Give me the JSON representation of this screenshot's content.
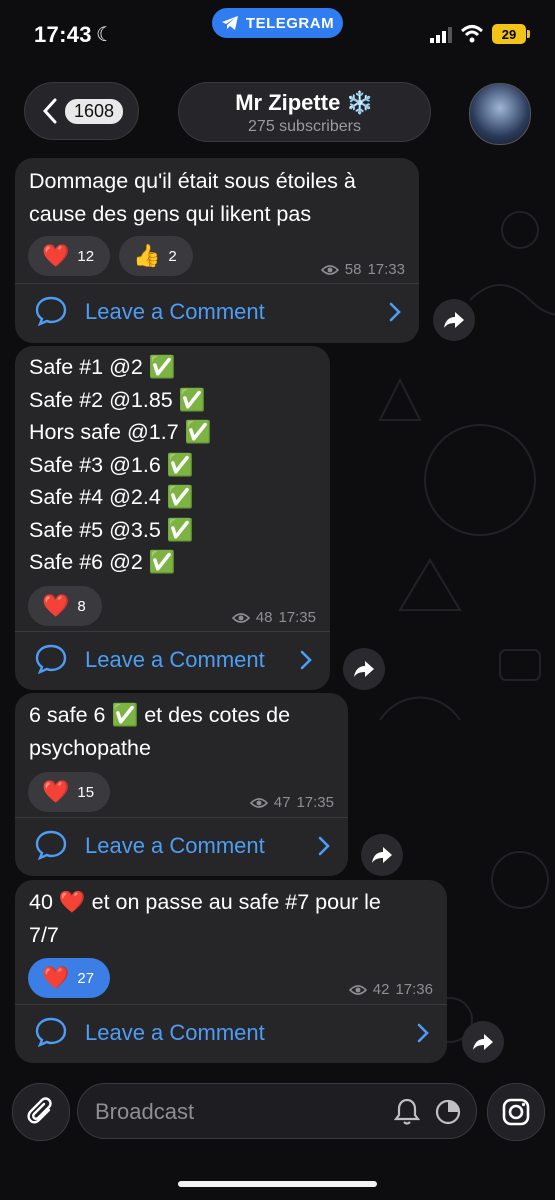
{
  "status_bar": {
    "time": "17:43",
    "battery": "29",
    "banner": "TELEGRAM"
  },
  "header": {
    "back_count": "1608",
    "channel_name": "Mr Zipette ❄️",
    "subscribers": "275 subscribers"
  },
  "messages": [
    {
      "text": "Dommage qu'il était sous étoiles à\ncause des gens qui likent pas",
      "reactions": [
        {
          "emoji": "❤️",
          "count": "12"
        },
        {
          "emoji": "👍",
          "count": "2"
        }
      ],
      "views": "58",
      "time": "17:33",
      "comment_label": "Leave a Comment"
    },
    {
      "text": "Safe #1 @2 ✅\nSafe #2 @1.85 ✅\nHors safe @1.7 ✅\nSafe #3 @1.6 ✅\nSafe #4 @2.4 ✅\nSafe #5 @3.5 ✅\nSafe #6 @2 ✅",
      "reactions": [
        {
          "emoji": "❤️",
          "count": "8"
        }
      ],
      "views": "48",
      "time": "17:35",
      "comment_label": "Leave a Comment"
    },
    {
      "text": "6 safe 6 ✅ et des cotes de\npsychopathe",
      "reactions": [
        {
          "emoji": "❤️",
          "count": "15"
        }
      ],
      "views": "47",
      "time": "17:35",
      "comment_label": "Leave a Comment"
    },
    {
      "text": "40 ❤️ et on passe au safe #7 pour le\n7/7",
      "reactions": [
        {
          "emoji": "❤️",
          "count": "27",
          "active": true
        }
      ],
      "views": "42",
      "time": "17:36",
      "comment_label": "Leave a Comment"
    }
  ],
  "composer": {
    "placeholder": "Broadcast"
  },
  "colors": {
    "accent": "#3a7ee6",
    "link": "#4d9df5",
    "bubble": "#262528",
    "background": "#0d0d10",
    "battery": "#f2c418"
  },
  "icons": [
    "moon-icon",
    "telegram-icon",
    "signal-icon",
    "wifi-icon",
    "back-chevron-icon",
    "comment-bubble-icon",
    "chevron-right-icon",
    "share-arrow-icon",
    "paperclip-icon",
    "bell-icon",
    "timer-icon",
    "instagram-icon"
  ]
}
